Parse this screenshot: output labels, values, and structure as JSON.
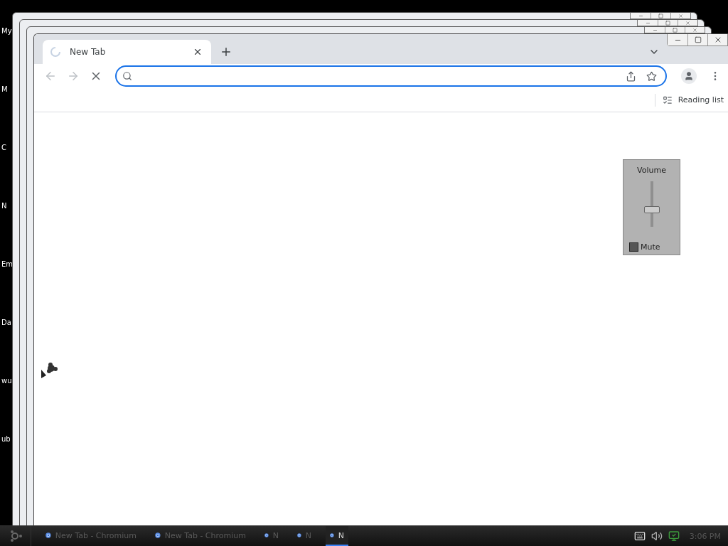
{
  "desktop_icons": [
    {
      "label": "My"
    },
    {
      "label": "M"
    },
    {
      "label": "C"
    },
    {
      "label": "N"
    },
    {
      "label": "Em"
    },
    {
      "label": "Da"
    },
    {
      "label": "wu"
    },
    {
      "label": "ub"
    }
  ],
  "browser": {
    "tabs": [
      {
        "label": "New Tab",
        "selected": true,
        "loading": true
      }
    ],
    "bookmarks_bar": {
      "reading_list": "Reading list"
    },
    "volume_panel": {
      "title": "Volume",
      "level": 0.38,
      "mute": {
        "label": "Mute",
        "checked": false
      }
    }
  },
  "taskbar": {
    "items": [
      {
        "label": "New Tab - Chromium",
        "selected": false
      },
      {
        "label": "New Tab - Chromium",
        "selected": false
      },
      {
        "label": "N",
        "selected": false
      },
      {
        "label": "N",
        "selected": false
      },
      {
        "label": "N",
        "selected": true
      }
    ],
    "clock": "3:06 PM"
  }
}
